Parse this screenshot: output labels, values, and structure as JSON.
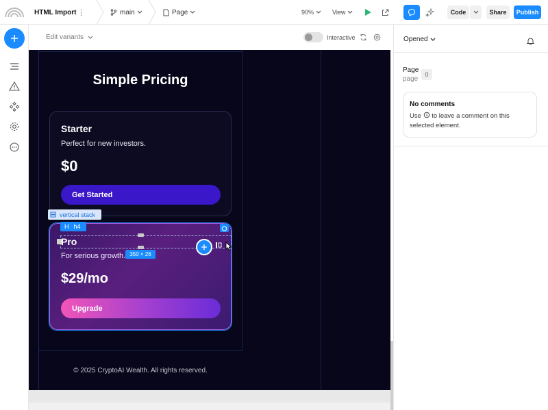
{
  "topbar": {
    "project_name": "HTML Import",
    "branch": "main",
    "page": "Page",
    "zoom": "90%",
    "view": "View",
    "code": "Code",
    "share": "Share",
    "publish": "Publish"
  },
  "canvasbar": {
    "edit_variants": "Edit variants",
    "interactive": "Interactive"
  },
  "canvas": {
    "title": "Simple Pricing",
    "starter": {
      "name": "Starter",
      "desc": "Perfect for new investors.",
      "price": "$0",
      "cta": "Get Started"
    },
    "pro": {
      "name": "Pro",
      "desc": "For serious growth.",
      "price": "$29/mo",
      "cta": "Upgrade"
    },
    "footer": "© 2025 CryptoAI Wealth. All rights reserved.",
    "selection": {
      "stack_label": "vertical stack",
      "tag_letter": "H",
      "tag_label": "h4",
      "dimensions": "350 × 26"
    }
  },
  "rightpanel": {
    "filter": "Opened",
    "page_title": "Page",
    "page_sub": "page",
    "count": "0",
    "empty_title": "No comments",
    "empty_text_a": "Use",
    "empty_text_b": "to leave a comment on this selected element."
  },
  "colors": {
    "accent": "#1a8cff",
    "canvas_bg": "#07061a",
    "starter_button": "#3a17c9",
    "pro_button_start": "#f255b8",
    "pro_button_end": "#6a2cd8"
  }
}
